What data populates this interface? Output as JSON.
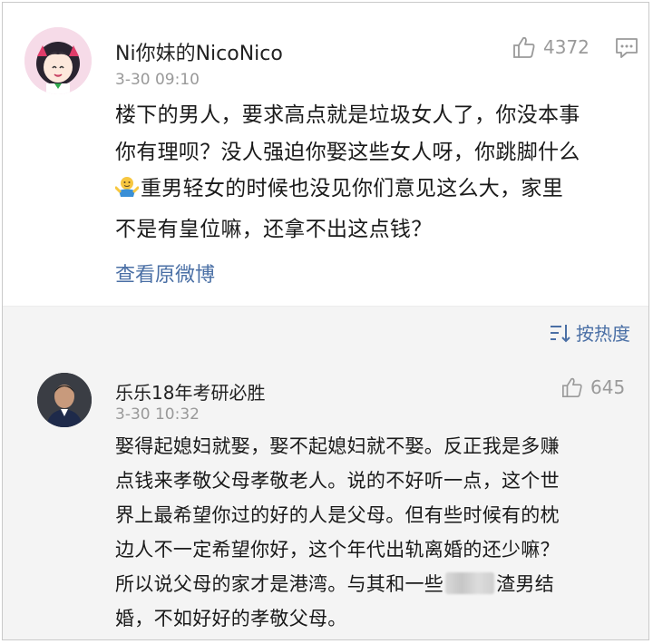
{
  "post": {
    "username": "Ni你妹的NicoNico",
    "timestamp": "3-30 09:10",
    "like_count": "4372",
    "body_lines": [
      "楼下的男人，要求高点就是垃圾女人了，你没本事",
      "你有理呗？没人强迫你娶这些女人呀，你跳脚什么",
      "重男轻女的时候也没见你们意见这么大，家里",
      "不是有皇位嘛，还拿不出这点钱？"
    ],
    "view_original": "查看原微博",
    "icons": [
      "avatar-anime-girl",
      "thumbs-up-icon",
      "comment-icon",
      "shrug-emoji"
    ]
  },
  "sort_bar": {
    "label": "按热度",
    "icon": "sort-icon"
  },
  "reply": {
    "username": "乐乐18年考研必胜",
    "timestamp": "3-30 10:32",
    "like_count": "645",
    "body_lines": [
      "娶得起媳妇就娶，娶不起媳妇就不娶。反正我是多赚",
      "点钱来孝敬父母孝敬老人。说的不好听一点，这个世",
      "界上最希望你过的好的人是父母。但有些时候有的枕",
      "边人不一定希望你好，这个年代出轨离婚的还少嘛？",
      "所以说父母的家才是港湾。与其和一些",
      "渣男结",
      "婚，不如好好的孝敬父母。"
    ]
  },
  "colors": {
    "link": "#4a6fa5",
    "meta": "#999999",
    "text": "#1a1a1a",
    "reply_bg": "#f4f4f4"
  }
}
